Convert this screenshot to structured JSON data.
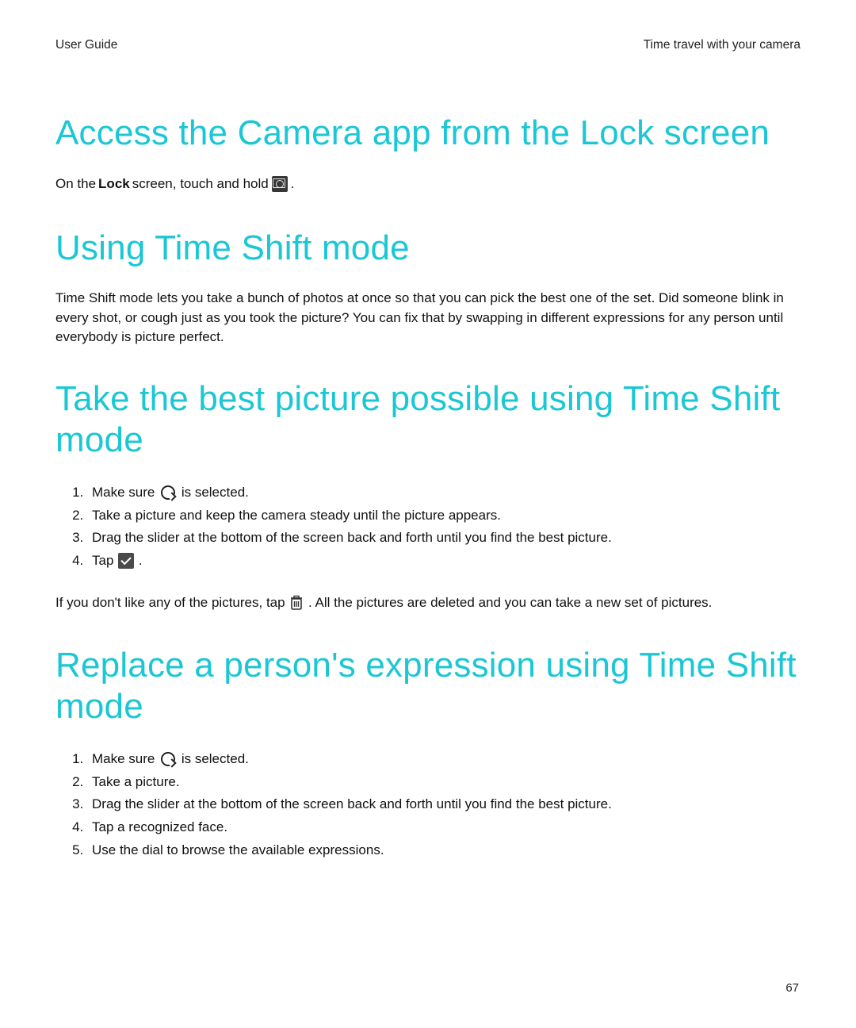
{
  "header": {
    "left": "User Guide",
    "right": "Time travel with your camera"
  },
  "section1": {
    "title": "Access the Camera app from the Lock screen",
    "intro_a": "On the ",
    "intro_bold": "Lock",
    "intro_b": " screen, touch and hold ",
    "intro_c": " ."
  },
  "section2": {
    "title": "Using Time Shift mode",
    "para": "Time Shift mode lets you take a bunch of photos at once so that you can pick the best one of the set. Did someone blink in every shot, or cough just as you took the picture? You can fix that by swapping in different expressions for any person until everybody is picture perfect."
  },
  "section3": {
    "title": "Take the best picture possible using Time Shift mode",
    "steps": [
      {
        "prefix": "Make sure ",
        "icon": "timeshift",
        "suffix": " is selected."
      },
      {
        "text": "Take a picture and keep the camera steady until the picture appears."
      },
      {
        "text": "Drag the slider at the bottom of the screen back and forth until you find the best picture."
      },
      {
        "prefix": "Tap ",
        "icon": "check",
        "suffix": " ."
      }
    ],
    "after_a": "If you don't like any of the pictures, tap ",
    "after_b": " . All the pictures are deleted and you can take a new set of pictures."
  },
  "section4": {
    "title": "Replace a person's expression using Time Shift mode",
    "steps": [
      {
        "prefix": "Make sure ",
        "icon": "timeshift",
        "suffix": " is selected."
      },
      {
        "text": "Take a picture."
      },
      {
        "text": "Drag the slider at the bottom of the screen back and forth until you find the best picture."
      },
      {
        "text": "Tap a recognized face."
      },
      {
        "text": "Use the dial to browse the available expressions."
      }
    ]
  },
  "page_number": "67"
}
